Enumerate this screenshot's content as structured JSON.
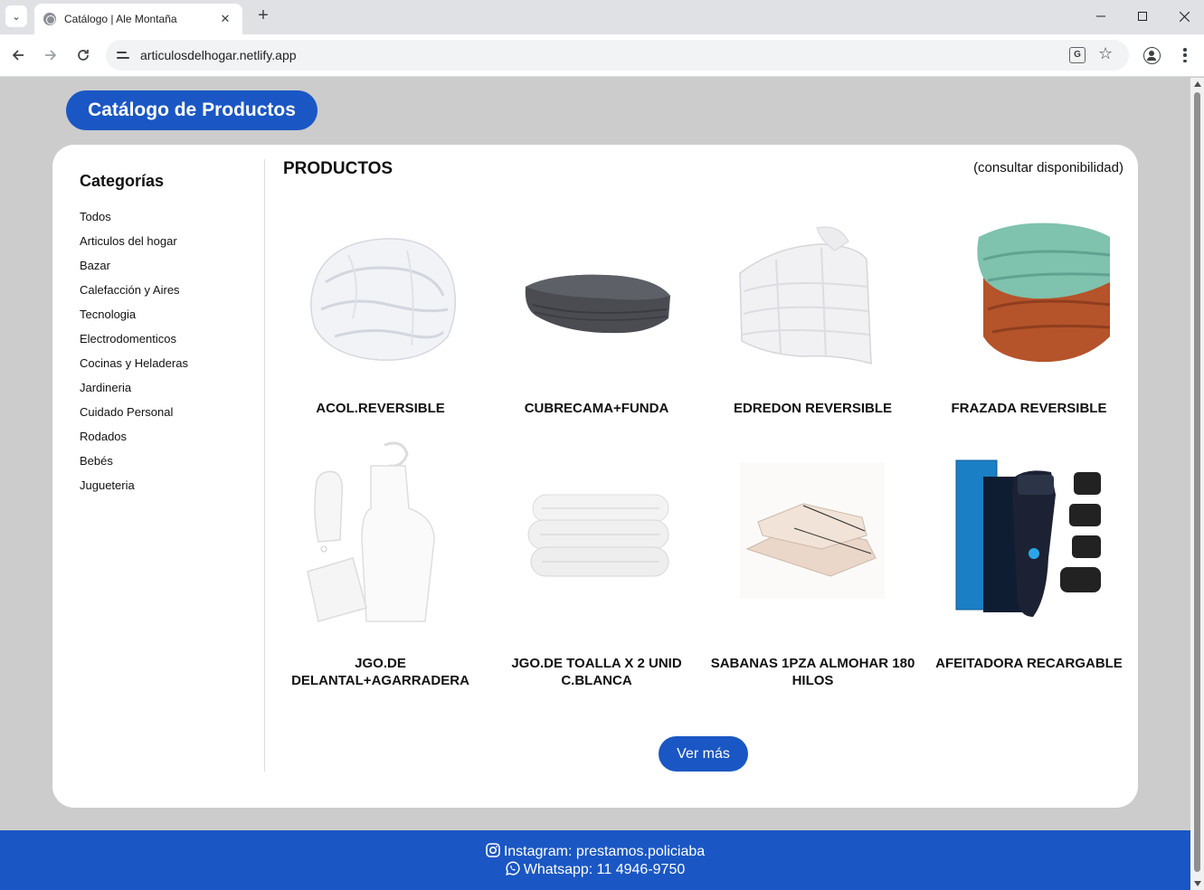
{
  "browser": {
    "tab_title": "Catálogo | Ale Montaña",
    "url": "articulosdelhogar.netlify.app",
    "new_tab_symbol": "+",
    "close_tab_symbol": "✕"
  },
  "page": {
    "title": "Catálogo de Productos",
    "sidebar": {
      "heading": "Categorías",
      "categories": [
        "Todos",
        "Articulos del hogar",
        "Bazar",
        "Calefacción y Aires",
        "Tecnologia",
        "Electrodomenticos",
        "Cocinas y Heladeras",
        "Jardineria",
        "Cuidado Personal",
        "Rodados",
        "Bebés",
        "Jugueteria"
      ]
    },
    "products_heading": "PRODUCTOS",
    "availability_note": "(consultar disponibilidad)",
    "products": [
      {
        "name": "ACOL.REVERSIBLE",
        "image": "white-comforter-image"
      },
      {
        "name": "CUBRECAMA+FUNDA",
        "image": "grey-bedspread-image"
      },
      {
        "name": "EDREDON REVERSIBLE",
        "image": "white-duvet-image"
      },
      {
        "name": "FRAZADA REVERSIBLE",
        "image": "blankets-image"
      },
      {
        "name": "JGO.DE DELANTAL+AGARRADERA",
        "image": "apron-set-image"
      },
      {
        "name": "JGO.DE TOALLA X 2 UNID C.BLANCA",
        "image": "towels-image"
      },
      {
        "name": "SABANAS 1PZA ALMOHAR 180 HILOS",
        "image": "sheets-image"
      },
      {
        "name": "AFEITADORA RECARGABLE",
        "image": "shaver-image"
      }
    ],
    "see_more_label": "Ver más",
    "footer": {
      "instagram": "Instagram: prestamos.policiaba",
      "whatsapp": "Whatsapp: 11 4946-9750"
    }
  },
  "colors": {
    "brand_blue": "#1a57c4",
    "page_background": "#cccccc",
    "card_background": "#ffffff"
  }
}
